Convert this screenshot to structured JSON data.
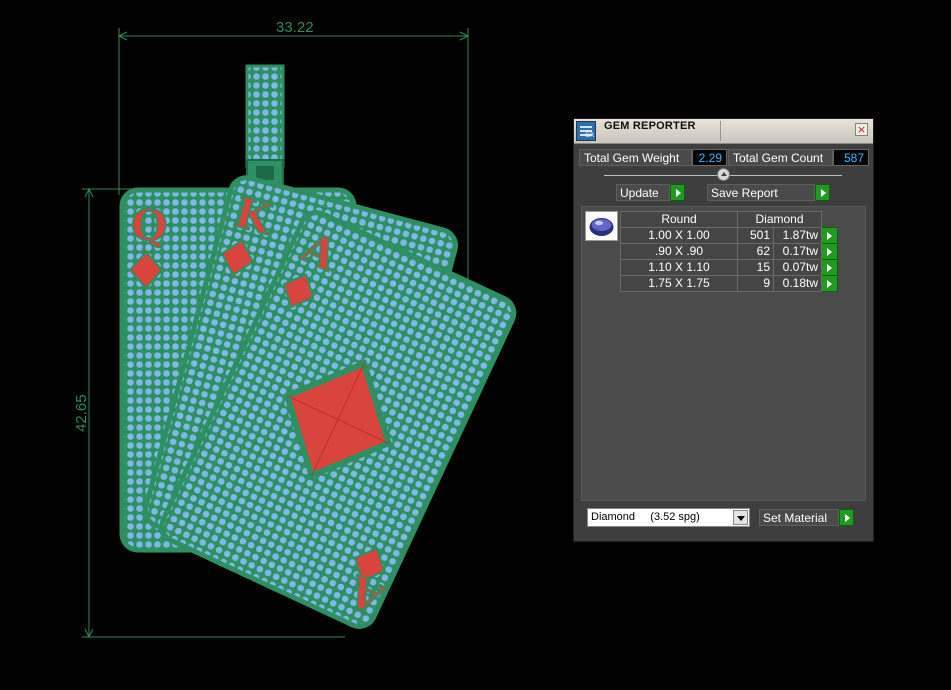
{
  "viewport": {
    "dimension_width": "33.22",
    "dimension_height": "42.65",
    "model": "card-pendant-3d-model",
    "card_letters": [
      "Q",
      "K",
      "A",
      "A"
    ]
  },
  "gem_reporter": {
    "title": "GEM REPORTER",
    "icon_label": "GR",
    "close_label": "×",
    "total_weight_label": "Total Gem Weight",
    "total_weight_value": "2.29",
    "total_count_label": "Total Gem Count",
    "total_count_value": "587",
    "update_label": "Update",
    "save_report_label": "Save Report",
    "table_headers": {
      "shape": "Round",
      "material": "Diamond"
    },
    "rows": [
      {
        "size": "1.00 X 1.00",
        "count": "501",
        "weight": "1.87tw"
      },
      {
        "size": ".90 X .90",
        "count": "62",
        "weight": "0.17tw"
      },
      {
        "size": "1.10 X 1.10",
        "count": "15",
        "weight": "0.07tw"
      },
      {
        "size": "1.75 X 1.75",
        "count": "9",
        "weight": "0.18tw"
      }
    ],
    "material_select_value": "Diamond     (3.52 spg)",
    "set_material_label": "Set Material"
  },
  "colors": {
    "card_green": "#2e8f63",
    "pave_blue": "#7fb8e6",
    "diamond_red": "#d9453d",
    "dimension_green": "#2f8c55",
    "value_text": "#3fb6ff"
  }
}
